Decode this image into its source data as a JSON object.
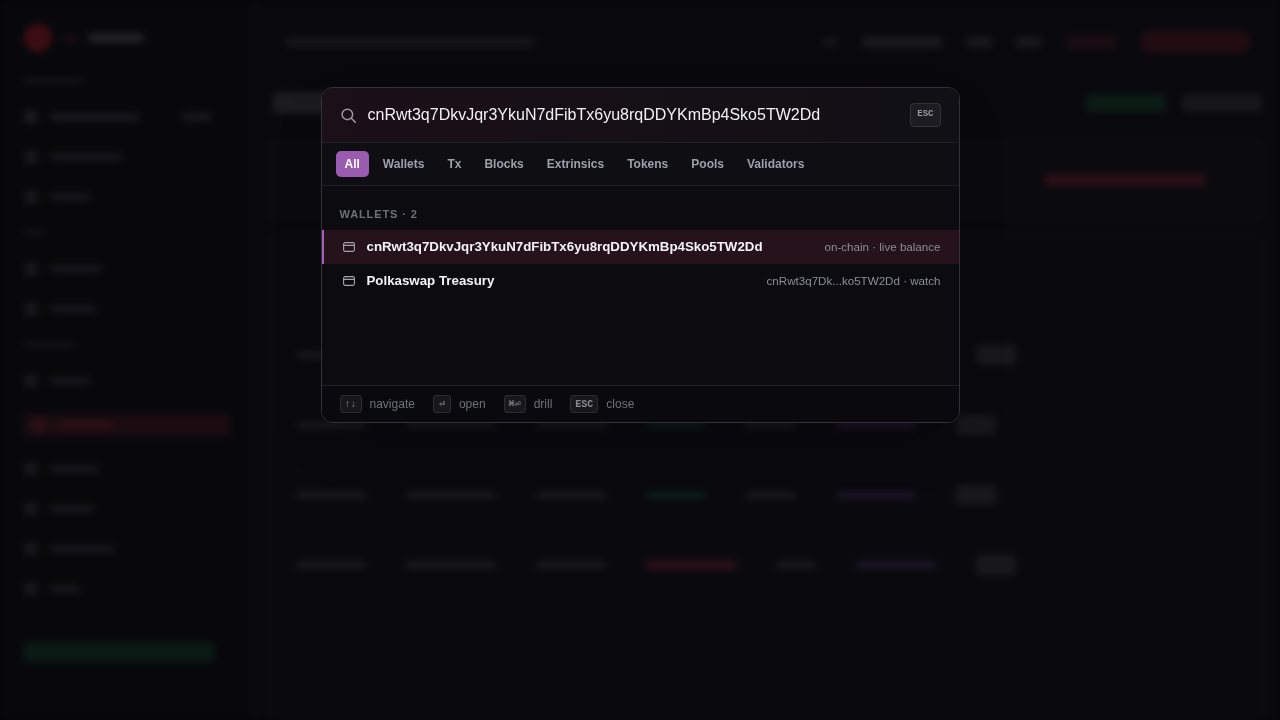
{
  "search": {
    "value": "cnRwt3q7DkvJqr3YkuN7dFibTx6yu8rqDDYKmBp4Sko5TW2Dd",
    "shortcut_key": "ESC"
  },
  "filter_tabs": [
    {
      "label": "All",
      "selected": true
    },
    {
      "label": "Wallets",
      "selected": false
    },
    {
      "label": "Tx",
      "selected": false
    },
    {
      "label": "Blocks",
      "selected": false
    },
    {
      "label": "Extrinsics",
      "selected": false
    },
    {
      "label": "Tokens",
      "selected": false
    },
    {
      "label": "Pools",
      "selected": false
    },
    {
      "label": "Validators",
      "selected": false
    }
  ],
  "result_groups": [
    {
      "heading": "WALLETS · 2",
      "items": [
        {
          "title": "cnRwt3q7DkvJqr3YkuN7dFibTx6yu8rqDDYKmBp4Sko5TW2Dd",
          "meta": "on-chain · live balance",
          "selected": true
        },
        {
          "title": "Polkaswap Treasury",
          "meta": "cnRwt3q7Dk...ko5TW2Dd · watch",
          "selected": false
        }
      ]
    }
  ],
  "footer_hints": [
    {
      "key": "↑↓",
      "label": "navigate"
    },
    {
      "key": "⏎",
      "label": "open"
    },
    {
      "key": "⌘⏎",
      "label": "drill"
    },
    {
      "key": "ESC",
      "label": "close"
    }
  ]
}
